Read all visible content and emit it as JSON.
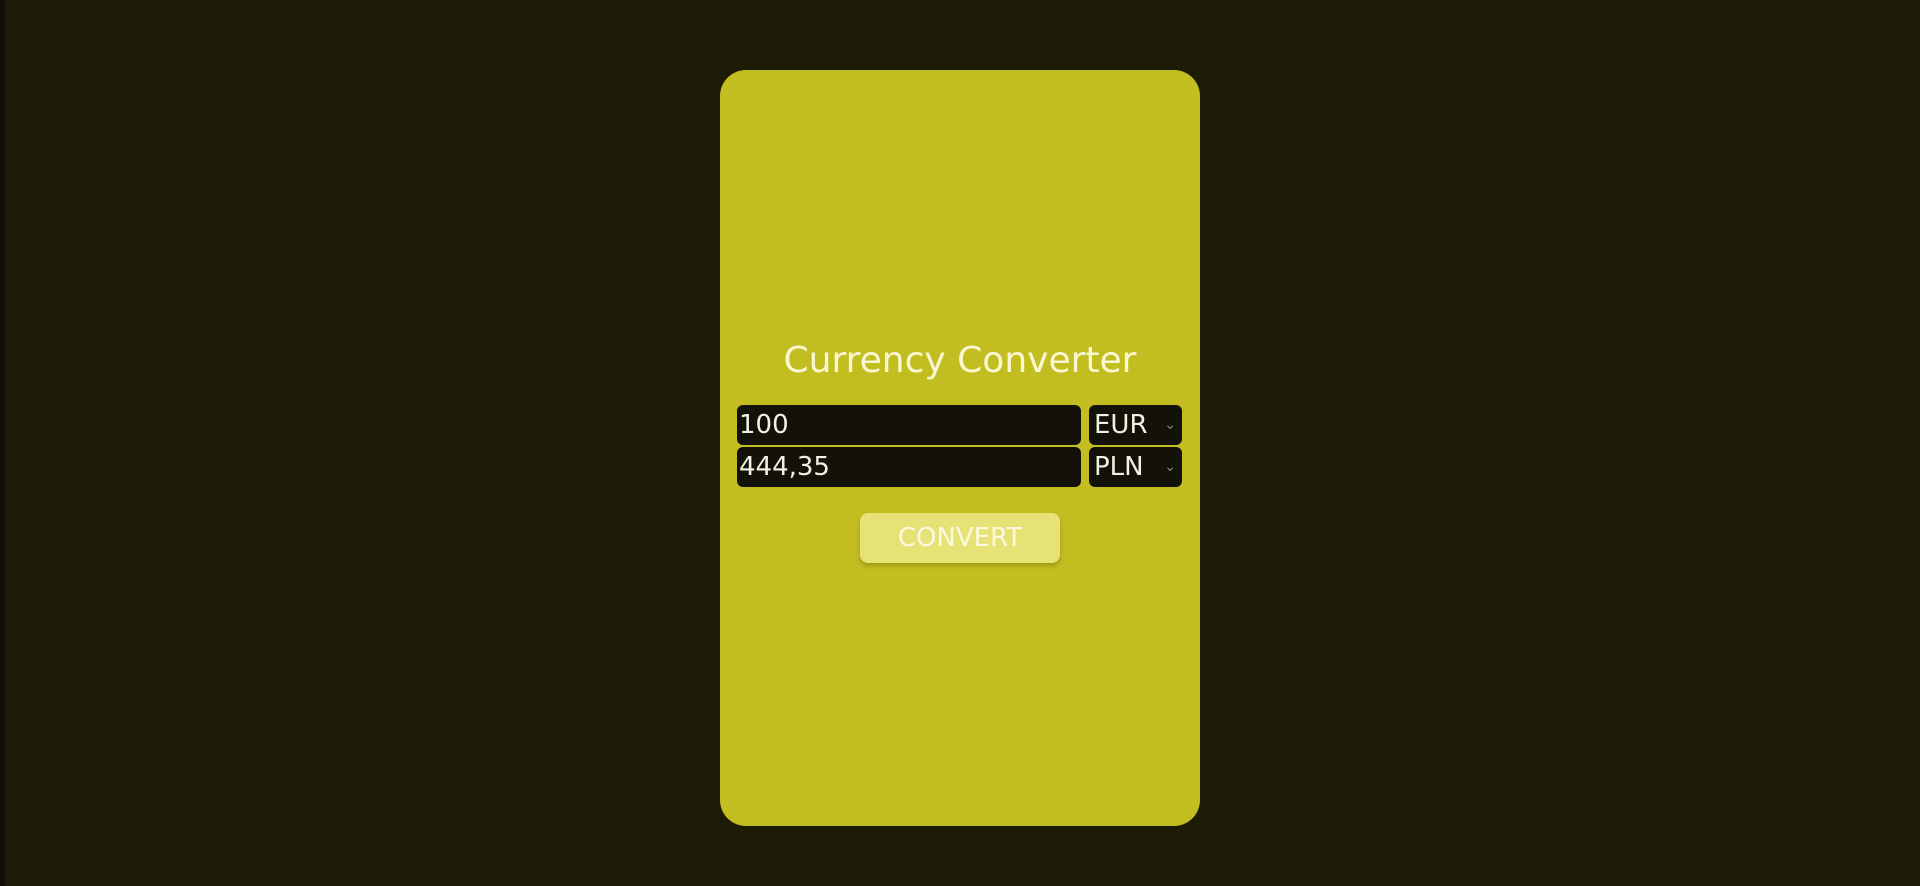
{
  "converter": {
    "title": "Currency Converter",
    "from": {
      "amount": "100",
      "currency": "EUR"
    },
    "to": {
      "amount": "444,35",
      "currency": "PLN"
    },
    "convert_label": "CONVERT"
  },
  "icons": {
    "dropdown": "chevron-down-icon"
  },
  "colors": {
    "page_background": "#1e1c06",
    "card": "#c2be21",
    "field_background": "#141208",
    "button": "#e6e276",
    "text_light": "#fbf7d2"
  }
}
